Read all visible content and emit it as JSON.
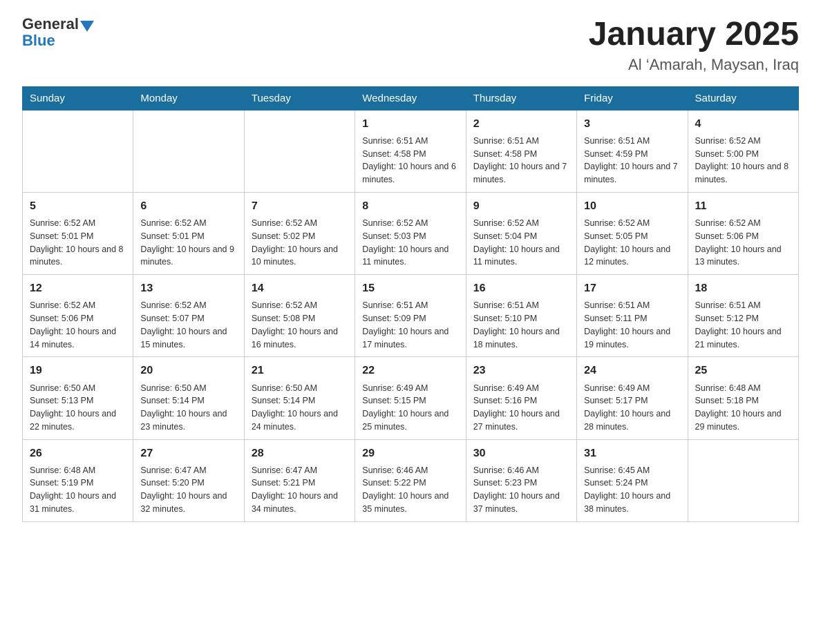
{
  "logo": {
    "general": "General",
    "blue": "Blue"
  },
  "header": {
    "title": "January 2025",
    "subtitle": "Al ‘Amarah, Maysan, Iraq"
  },
  "days_header": [
    "Sunday",
    "Monday",
    "Tuesday",
    "Wednesday",
    "Thursday",
    "Friday",
    "Saturday"
  ],
  "weeks": [
    [
      {
        "day": "",
        "info": ""
      },
      {
        "day": "",
        "info": ""
      },
      {
        "day": "",
        "info": ""
      },
      {
        "day": "1",
        "info": "Sunrise: 6:51 AM\nSunset: 4:58 PM\nDaylight: 10 hours and 6 minutes."
      },
      {
        "day": "2",
        "info": "Sunrise: 6:51 AM\nSunset: 4:58 PM\nDaylight: 10 hours and 7 minutes."
      },
      {
        "day": "3",
        "info": "Sunrise: 6:51 AM\nSunset: 4:59 PM\nDaylight: 10 hours and 7 minutes."
      },
      {
        "day": "4",
        "info": "Sunrise: 6:52 AM\nSunset: 5:00 PM\nDaylight: 10 hours and 8 minutes."
      }
    ],
    [
      {
        "day": "5",
        "info": "Sunrise: 6:52 AM\nSunset: 5:01 PM\nDaylight: 10 hours and 8 minutes."
      },
      {
        "day": "6",
        "info": "Sunrise: 6:52 AM\nSunset: 5:01 PM\nDaylight: 10 hours and 9 minutes."
      },
      {
        "day": "7",
        "info": "Sunrise: 6:52 AM\nSunset: 5:02 PM\nDaylight: 10 hours and 10 minutes."
      },
      {
        "day": "8",
        "info": "Sunrise: 6:52 AM\nSunset: 5:03 PM\nDaylight: 10 hours and 11 minutes."
      },
      {
        "day": "9",
        "info": "Sunrise: 6:52 AM\nSunset: 5:04 PM\nDaylight: 10 hours and 11 minutes."
      },
      {
        "day": "10",
        "info": "Sunrise: 6:52 AM\nSunset: 5:05 PM\nDaylight: 10 hours and 12 minutes."
      },
      {
        "day": "11",
        "info": "Sunrise: 6:52 AM\nSunset: 5:06 PM\nDaylight: 10 hours and 13 minutes."
      }
    ],
    [
      {
        "day": "12",
        "info": "Sunrise: 6:52 AM\nSunset: 5:06 PM\nDaylight: 10 hours and 14 minutes."
      },
      {
        "day": "13",
        "info": "Sunrise: 6:52 AM\nSunset: 5:07 PM\nDaylight: 10 hours and 15 minutes."
      },
      {
        "day": "14",
        "info": "Sunrise: 6:52 AM\nSunset: 5:08 PM\nDaylight: 10 hours and 16 minutes."
      },
      {
        "day": "15",
        "info": "Sunrise: 6:51 AM\nSunset: 5:09 PM\nDaylight: 10 hours and 17 minutes."
      },
      {
        "day": "16",
        "info": "Sunrise: 6:51 AM\nSunset: 5:10 PM\nDaylight: 10 hours and 18 minutes."
      },
      {
        "day": "17",
        "info": "Sunrise: 6:51 AM\nSunset: 5:11 PM\nDaylight: 10 hours and 19 minutes."
      },
      {
        "day": "18",
        "info": "Sunrise: 6:51 AM\nSunset: 5:12 PM\nDaylight: 10 hours and 21 minutes."
      }
    ],
    [
      {
        "day": "19",
        "info": "Sunrise: 6:50 AM\nSunset: 5:13 PM\nDaylight: 10 hours and 22 minutes."
      },
      {
        "day": "20",
        "info": "Sunrise: 6:50 AM\nSunset: 5:14 PM\nDaylight: 10 hours and 23 minutes."
      },
      {
        "day": "21",
        "info": "Sunrise: 6:50 AM\nSunset: 5:14 PM\nDaylight: 10 hours and 24 minutes."
      },
      {
        "day": "22",
        "info": "Sunrise: 6:49 AM\nSunset: 5:15 PM\nDaylight: 10 hours and 25 minutes."
      },
      {
        "day": "23",
        "info": "Sunrise: 6:49 AM\nSunset: 5:16 PM\nDaylight: 10 hours and 27 minutes."
      },
      {
        "day": "24",
        "info": "Sunrise: 6:49 AM\nSunset: 5:17 PM\nDaylight: 10 hours and 28 minutes."
      },
      {
        "day": "25",
        "info": "Sunrise: 6:48 AM\nSunset: 5:18 PM\nDaylight: 10 hours and 29 minutes."
      }
    ],
    [
      {
        "day": "26",
        "info": "Sunrise: 6:48 AM\nSunset: 5:19 PM\nDaylight: 10 hours and 31 minutes."
      },
      {
        "day": "27",
        "info": "Sunrise: 6:47 AM\nSunset: 5:20 PM\nDaylight: 10 hours and 32 minutes."
      },
      {
        "day": "28",
        "info": "Sunrise: 6:47 AM\nSunset: 5:21 PM\nDaylight: 10 hours and 34 minutes."
      },
      {
        "day": "29",
        "info": "Sunrise: 6:46 AM\nSunset: 5:22 PM\nDaylight: 10 hours and 35 minutes."
      },
      {
        "day": "30",
        "info": "Sunrise: 6:46 AM\nSunset: 5:23 PM\nDaylight: 10 hours and 37 minutes."
      },
      {
        "day": "31",
        "info": "Sunrise: 6:45 AM\nSunset: 5:24 PM\nDaylight: 10 hours and 38 minutes."
      },
      {
        "day": "",
        "info": ""
      }
    ]
  ]
}
